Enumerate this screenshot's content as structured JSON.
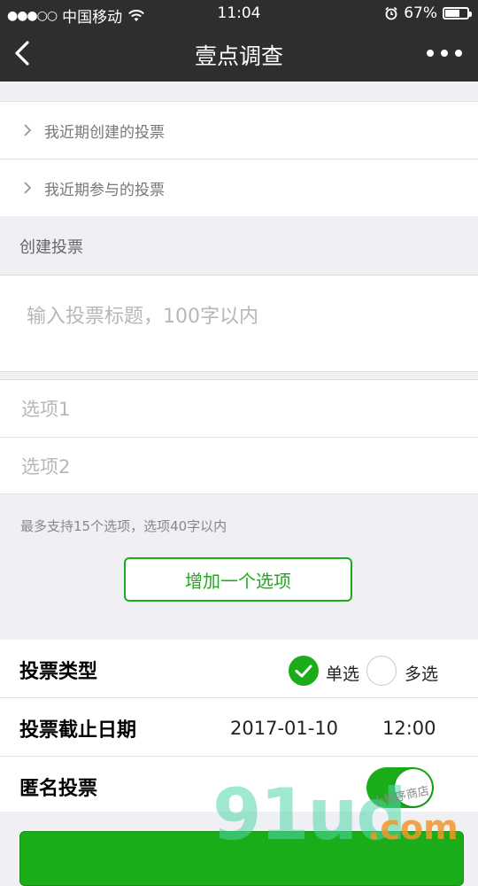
{
  "status_bar": {
    "signal_dots": "●●●○○",
    "carrier": "中国移动",
    "time": "11:04",
    "battery_percent": "67%",
    "battery_level": 0.67
  },
  "navbar": {
    "title": "壹点调查"
  },
  "recent": {
    "items": [
      {
        "label": "我近期创建的投票"
      },
      {
        "label": "我近期参与的投票"
      }
    ]
  },
  "create": {
    "section_label": "创建投票",
    "title_placeholder": "输入投票标题，100字以内",
    "options": [
      {
        "placeholder": "选项1"
      },
      {
        "placeholder": "选项2"
      }
    ],
    "hint": "最多支持15个选项，选项40字以内",
    "add_option_label": "增加一个选项"
  },
  "settings": {
    "vote_type_label": "投票类型",
    "single_label": "单选",
    "multi_label": "多选",
    "single_selected": true,
    "deadline_label": "投票截止日期",
    "deadline_date": "2017-01-10",
    "deadline_time": "12:00",
    "anonymous_label": "匿名投票",
    "anonymous_on": true
  },
  "watermark": {
    "main": "91ud",
    "suffix": ".com",
    "caption": "小程序商店"
  },
  "colors": {
    "accent": "#1aad19",
    "header_bg": "#2e2e2e",
    "page_bg": "#efeff4"
  }
}
